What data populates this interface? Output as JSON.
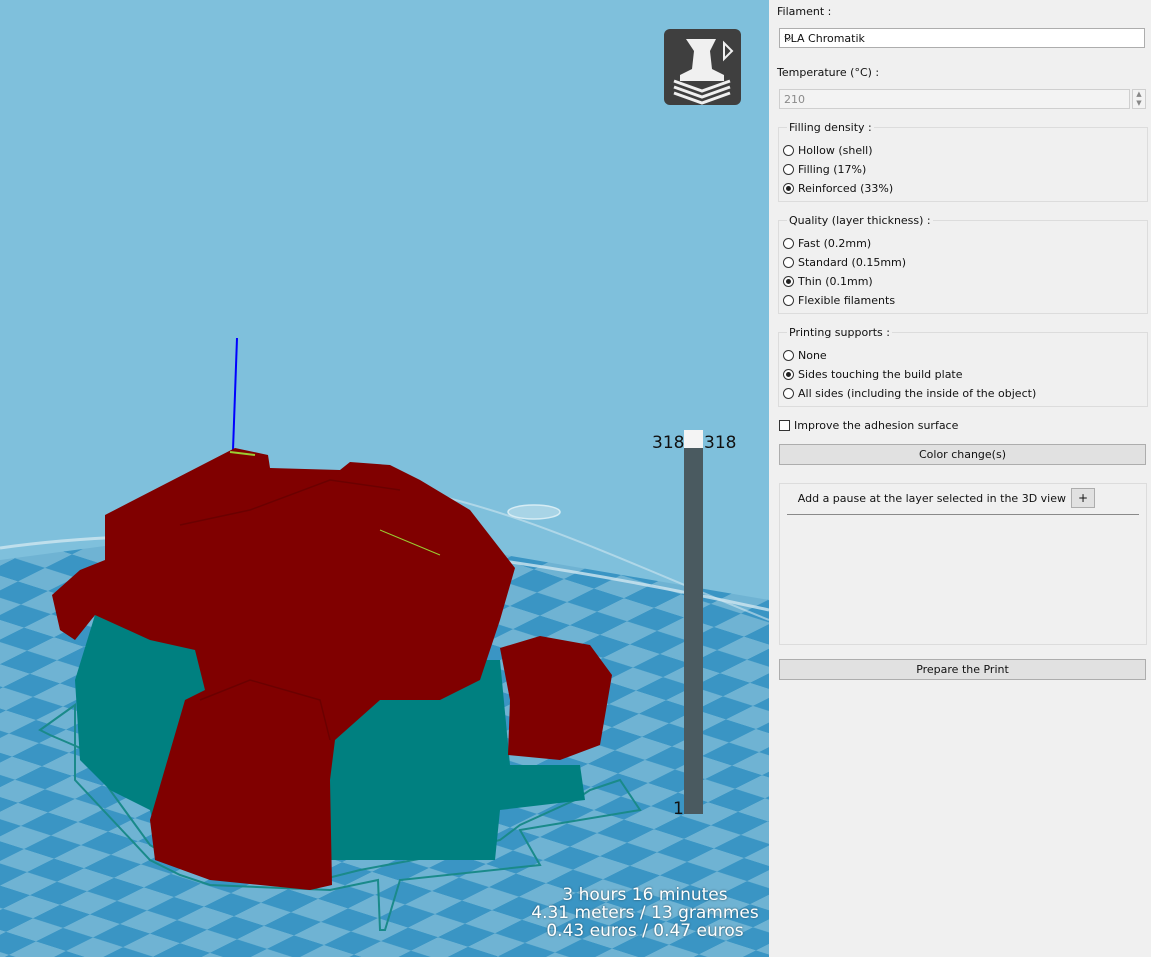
{
  "viewport": {
    "layer_top_left": "318",
    "layer_top_right": "318",
    "layer_bottom": "1",
    "stats": {
      "time": "3 hours 16 minutes",
      "material": "4.31 meters / 13 grammes",
      "cost": "0.43 euros / 0.47 euros"
    },
    "colors": {
      "background": "#7fc0dc",
      "bed_tile_dark": "#3a95c4",
      "bed_tile_light": "#6fb3d3",
      "model_outer": "#800000",
      "model_inner": "#008080"
    },
    "view_button_icon": "printer-layers-icon"
  },
  "panel": {
    "filament_label": "Filament :",
    "filament_value": "PLA Chromatik",
    "temperature_label": "Temperature (°C) :",
    "temperature_value": "210",
    "filling": {
      "title": "Filling density :",
      "options": [
        "Hollow (shell)",
        "Filling (17%)",
        "Reinforced  (33%)"
      ],
      "selected": 2
    },
    "quality": {
      "title": "Quality (layer thickness) :",
      "options": [
        "Fast (0.2mm)",
        "Standard (0.15mm)",
        "Thin (0.1mm)",
        "Flexible filaments"
      ],
      "selected": 2
    },
    "supports": {
      "title": "Printing supports :",
      "options": [
        "None",
        "Sides touching the build plate",
        "All sides (including the inside of the object)"
      ],
      "selected": 1
    },
    "adhesion_label": "Improve the adhesion surface",
    "color_change_label": "Color change(s)",
    "pause_label": "Add a pause at the layer selected in the 3D view",
    "plus_label": "+",
    "prepare_label": "Prepare the Print"
  }
}
